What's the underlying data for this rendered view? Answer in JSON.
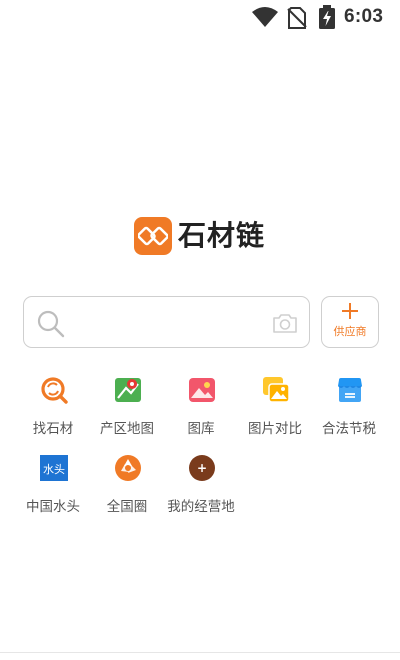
{
  "status_bar": {
    "time": "6:03",
    "icons": [
      "wifi-icon",
      "no-sim-icon",
      "battery-charging-icon"
    ]
  },
  "app": {
    "logo_text": "石材链",
    "brand_color": "#f07a26"
  },
  "search": {
    "value": "",
    "placeholder": "",
    "icons": [
      "search-icon",
      "camera-icon"
    ]
  },
  "supplier_button": {
    "label": "供应商",
    "icon": "plus-icon"
  },
  "menu": {
    "items": [
      {
        "label": "找石材",
        "icon": "find-stone-icon"
      },
      {
        "label": "产区地图",
        "icon": "map-icon"
      },
      {
        "label": "图库",
        "icon": "gallery-icon"
      },
      {
        "label": "图片对比",
        "icon": "image-compare-icon"
      },
      {
        "label": "合法节税",
        "icon": "tax-icon"
      },
      {
        "label": "中国水头",
        "icon": "shuitou-logo-icon",
        "icon_text": "水头"
      },
      {
        "label": "全国圈",
        "icon": "national-circle-icon"
      },
      {
        "label": "我的经营地",
        "icon": "my-location-icon",
        "icon_text": "+"
      }
    ]
  }
}
